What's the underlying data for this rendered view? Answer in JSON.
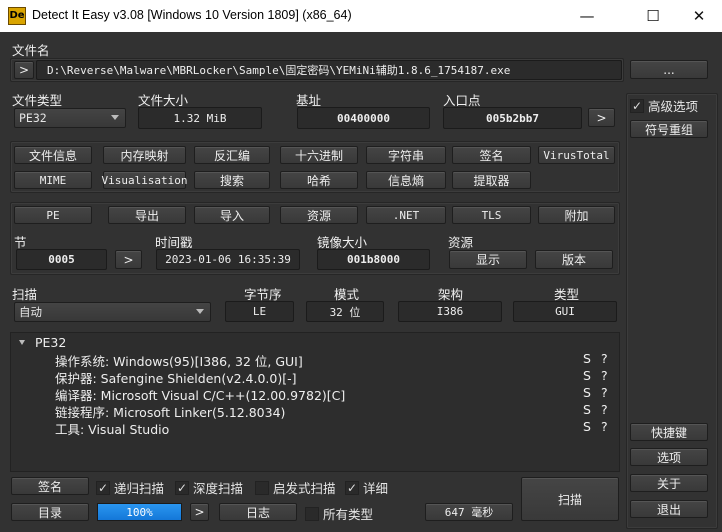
{
  "window": {
    "title": "Detect It Easy v3.08 [Windows 10 Version 1809] (x86_64)",
    "logo": "De",
    "minimize": "—",
    "maximize": "☐",
    "close": "✕"
  },
  "file": {
    "label": "文件名",
    "expand": ">",
    "path": "D:\\Reverse\\Malware\\MBRLocker\\Sample\\固定密码\\YEMiNi辅助1.8.6_1754187.exe",
    "browse": "..."
  },
  "info": {
    "type_label": "文件类型",
    "type_value": "PE32",
    "size_label": "文件大小",
    "size_value": "1.32 MiB",
    "base_label": "基址",
    "base_value": "00400000",
    "entry_label": "入口点",
    "entry_value": "005b2bb7",
    "entry_btn": ">"
  },
  "tools_row1": [
    "文件信息",
    "内存映射",
    "反汇编",
    "十六进制",
    "字符串",
    "签名",
    "VirusTotal"
  ],
  "tools_row2": [
    "MIME",
    "Visualisation",
    "搜索",
    "哈希",
    "信息熵",
    "提取器"
  ],
  "pe_row": [
    "PE",
    "导出",
    "导入",
    "资源",
    ".NET",
    "TLS",
    "附加"
  ],
  "pe": {
    "section_label": "节",
    "section_value": "0005",
    "section_btn": ">",
    "time_label": "时间戳",
    "time_value": "2023-01-06 16:35:39",
    "image_label": "镜像大小",
    "image_value": "001b8000",
    "res_label": "资源",
    "res_show": "显示",
    "res_version": "版本"
  },
  "scan": {
    "label": "扫描",
    "mode_value": "自动",
    "endian_label": "字节序",
    "endian_value": "LE",
    "bits_label": "模式",
    "bits_value": "32 位",
    "arch_label": "架构",
    "arch_value": "I386",
    "type_label": "类型",
    "type_value": "GUI"
  },
  "results": {
    "root": "PE32",
    "items": [
      {
        "text": "操作系统: Windows(95)[I386, 32 位, GUI]",
        "s": "S",
        "q": "?"
      },
      {
        "text": "保护器: Safengine Shielden(v2.4.0.0)[-]",
        "s": "S",
        "q": "?"
      },
      {
        "text": "编译器: Microsoft Visual C/C++(12.00.9782)[C]",
        "s": "S",
        "q": "?"
      },
      {
        "text": "链接程序: Microsoft Linker(5.12.8034)",
        "s": "S",
        "q": "?"
      },
      {
        "text": "工具: Visual Studio",
        "s": "S",
        "q": "?"
      }
    ]
  },
  "bottom": {
    "signatures": "签名",
    "recursive": "递归扫描",
    "deep": "深度扫描",
    "heuristic": "启发式扫描",
    "verbose": "详细",
    "directory": "目录",
    "progress": "100%",
    "progress_value": 100,
    "next": ">",
    "log": "日志",
    "all_types": "所有类型",
    "time": "647 毫秒",
    "scan": "扫描",
    "check": "✓"
  },
  "side": {
    "advanced": "高级选项",
    "demangle": "符号重组",
    "shortcuts": "快捷键",
    "options": "选项",
    "about": "关于",
    "exit": "退出"
  },
  "colors": {
    "accent": "#1e8ae6",
    "bg": "#323232"
  }
}
